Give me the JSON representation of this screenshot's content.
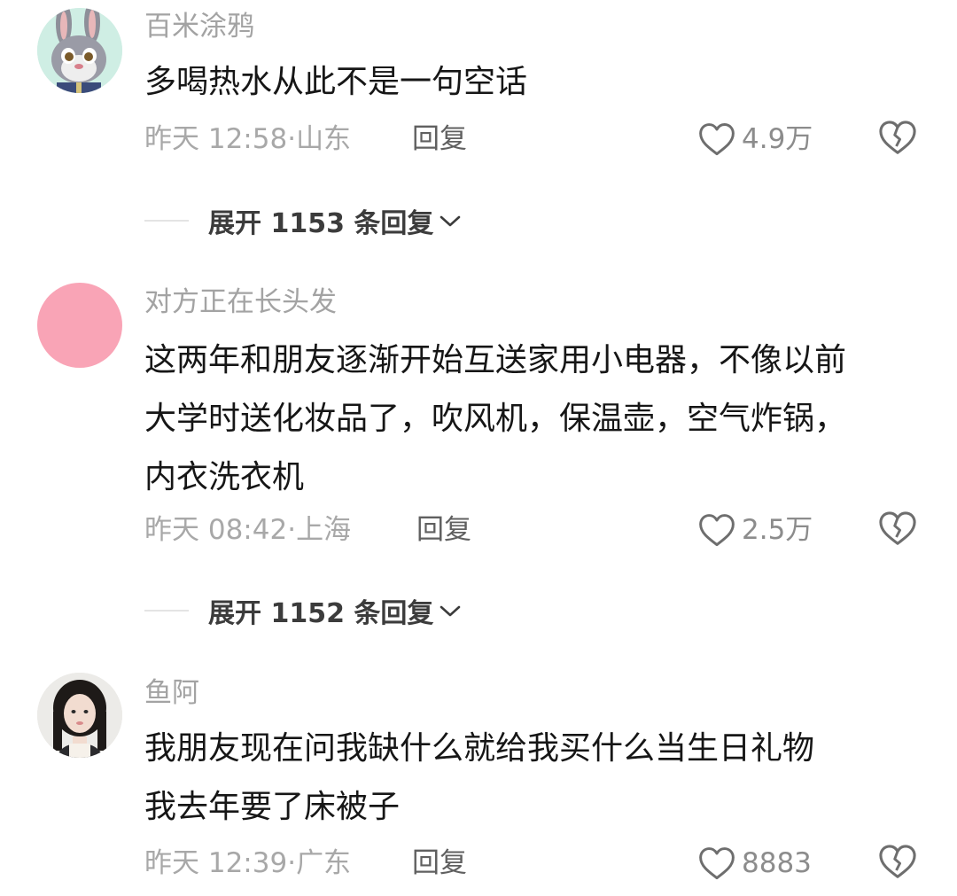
{
  "comments": [
    {
      "username": "百米涂鸦",
      "avatar": "bunny-cartoon-avatar",
      "lines": [
        "多喝热水从此不是一句空话"
      ],
      "time": "昨天 12:58",
      "location": "山东",
      "reply_label": "回复",
      "likes": "4.9万",
      "expand_label": "展开 1153 条回复"
    },
    {
      "username": "对方正在长头发",
      "avatar": "pink-circle-avatar",
      "lines": [
        "这两年和朋友逐渐开始互送家用小电器，不像以前",
        "大学时送化妆品了，吹风机，保温壶，空气炸锅，",
        "内衣洗衣机"
      ],
      "time": "昨天 08:42",
      "location": "上海",
      "reply_label": "回复",
      "likes": "2.5万",
      "expand_label": "展开 1152 条回复"
    },
    {
      "username": "鱼阿",
      "avatar": "girl-photo-avatar",
      "lines": [
        "我朋友现在问我缺什么就给我买什么当生日礼物",
        "我去年要了床被子"
      ],
      "time": "昨天 12:39",
      "location": "广东",
      "reply_label": "回复",
      "likes": "8883"
    }
  ],
  "meta_separator": "·",
  "icons": {
    "like": "heart-outline-icon",
    "dislike": "broken-heart-icon",
    "expand": "chevron-down-icon"
  },
  "colors": {
    "username": "#a3a3a3",
    "meta": "#a8a8a8",
    "avatar_pink": "#f9a4b6"
  }
}
